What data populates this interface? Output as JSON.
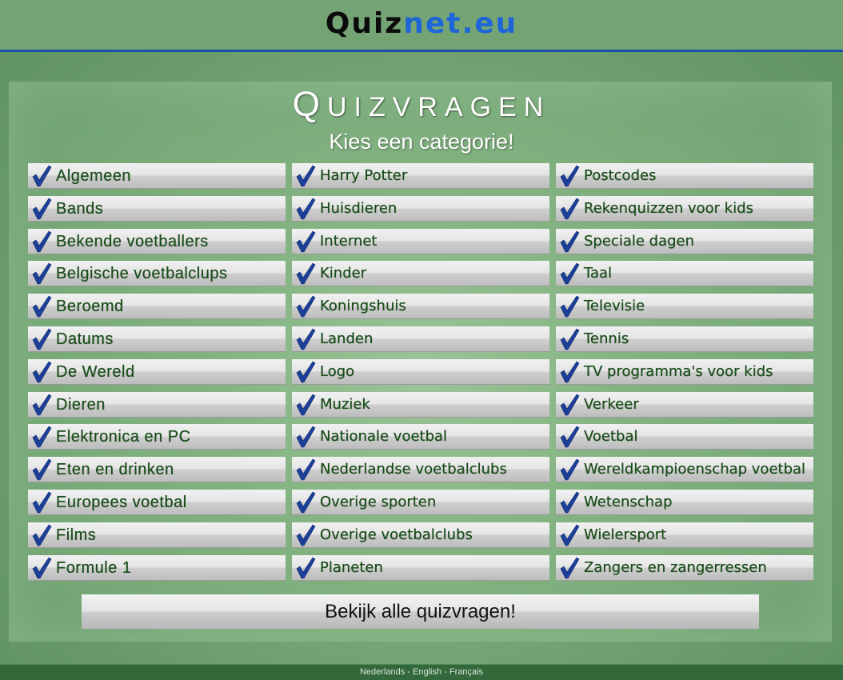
{
  "header": {
    "logo_part1": "Quiz",
    "logo_part2": "net.eu",
    "colors": {
      "logo_dark": "#0b0b0b",
      "logo_blue": "#1e66d8",
      "rule": "#1f4fa8"
    }
  },
  "main": {
    "title": "Quizvragen",
    "subtitle": "Kies een categorie!",
    "columns": [
      [
        "Algemeen",
        "Bands",
        "Bekende voetballers",
        "Belgische voetbalclups",
        "Beroemd",
        "Datums",
        "De Wereld",
        "Dieren",
        "Elektronica en PC",
        "Eten en drinken",
        "Europees voetbal",
        "Films",
        "Formule 1"
      ],
      [
        "Harry Potter",
        "Huisdieren",
        "Internet",
        "Kinder",
        "Koningshuis",
        "Landen",
        "Logo",
        "Muziek",
        "Nationale voetbal",
        "Nederlandse voetbalclubs",
        "Overige sporten",
        "Overige voetbalclubs",
        "Planeten"
      ],
      [
        "Postcodes",
        "Rekenquizzen voor kids",
        "Speciale dagen",
        "Taal",
        "Televisie",
        "Tennis",
        "TV programma's voor kids",
        "Verkeer",
        "Voetbal",
        "Wereldkampioenschap voetbal",
        "Wetenschap",
        "Wielersport",
        "Zangers en zangerressen"
      ]
    ],
    "check_icon": "checkmark-icon",
    "all_button_label": "Bekijk alle quizvragen!"
  },
  "footer": {
    "languages": [
      "Nederlands",
      "English",
      "Français"
    ],
    "separator": " - "
  }
}
